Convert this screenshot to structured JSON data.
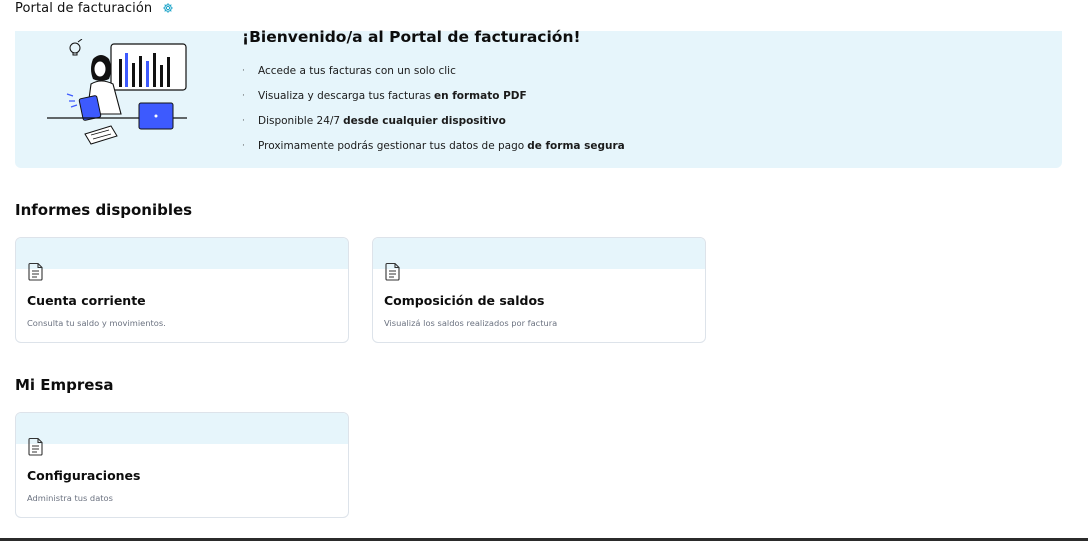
{
  "header": {
    "title": "Portal de facturación",
    "icon": "gear-icon"
  },
  "banner": {
    "title": "¡Bienvenido/a al Portal de facturación!",
    "bullet": "·",
    "items": [
      {
        "text": "Accede a tus facturas con un solo clic",
        "bold": ""
      },
      {
        "text": "Visualiza y descarga tus facturas",
        "bold": "en formato PDF"
      },
      {
        "text": "Disponible 24/7",
        "bold": "desde cualquier dispositivo"
      },
      {
        "text": "Proximamente podrás gestionar tus datos de pago",
        "bold": "de forma segura"
      }
    ],
    "colors": {
      "background": "#e6f5fb",
      "accent": "#3d5afe"
    }
  },
  "sections": [
    {
      "title": "Informes disponibles",
      "cards": [
        {
          "title": "Cuenta corriente",
          "description": "Consulta tu saldo y movimientos.",
          "icon": "document-icon"
        },
        {
          "title": "Composición de saldos",
          "description": "Visualizá los saldos realizados por factura",
          "icon": "document-icon"
        }
      ]
    },
    {
      "title": "Mi Empresa",
      "cards": [
        {
          "title": "Configuraciones",
          "description": "Administra tus datos",
          "icon": "document-icon"
        }
      ]
    }
  ]
}
